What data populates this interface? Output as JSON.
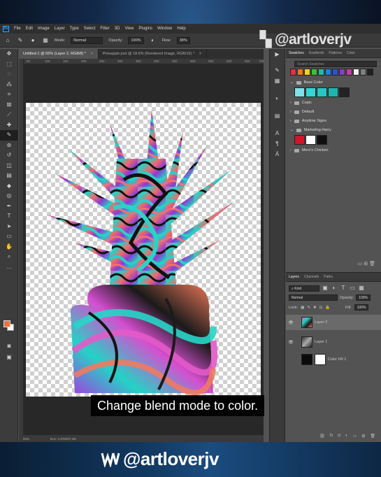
{
  "app": {
    "logo": "Ps"
  },
  "menu": [
    "File",
    "Edit",
    "Image",
    "Layer",
    "Type",
    "Select",
    "Filter",
    "3D",
    "View",
    "Plugins",
    "Window",
    "Help"
  ],
  "options": {
    "mode_label": "Mode:",
    "mode_value": "Normal",
    "opacity_label": "Opacity:",
    "opacity_value": "100%",
    "flow_label": "Flow:",
    "flow_value": "38%"
  },
  "doc_tabs": [
    {
      "label": "Untitled-1 @ 55% (Layer 2, RGB/8) *",
      "active": true
    },
    {
      "label": "Pineapple.psd @ 18.6% (Rendered Image, RGB/16) *",
      "active": false
    }
  ],
  "ruler_ticks": [
    "50",
    "100",
    "150",
    "200",
    "250",
    "300",
    "350",
    "400",
    "450",
    "500",
    "550",
    "600",
    "650",
    "700"
  ],
  "status": {
    "zoom": "55%",
    "doc": "Doc: 4.37M/37.2M"
  },
  "caption": "Change blend mode to color.",
  "watermark": "@artloverjv",
  "swatches_panel": {
    "tabs": [
      "Swatches",
      "Gradients",
      "Patterns",
      "Color"
    ],
    "search_placeholder": "Search Swatches",
    "recent_colors": [
      "#e03040",
      "#f07820",
      "#f0d020",
      "#3ac03a",
      "#28b8a0",
      "#2080e0",
      "#3050d0",
      "#8040c0",
      "#c040a0",
      "#f0f0f0",
      "#808080",
      "#202020"
    ],
    "groups": [
      {
        "name": "Base Color",
        "open": true,
        "colors": [
          "#7de3e8",
          "#35d6d6",
          "#27c7c2",
          "#1fb5ae",
          "#222222"
        ]
      },
      {
        "name": "Copic",
        "open": false
      },
      {
        "name": "Default",
        "open": false
      },
      {
        "name": "Anytime Signs",
        "open": false
      },
      {
        "name": "Marketing Harry",
        "open": true,
        "colors": [
          "#d0142c",
          "#ffffff",
          "#101010"
        ]
      },
      {
        "name": "Mero's Chicken",
        "open": false
      }
    ]
  },
  "layers_panel": {
    "tabs": [
      "Layers",
      "Channels",
      "Paths"
    ],
    "filter_label": "Kind",
    "blend_mode": "Normal",
    "opacity_label": "Opacity:",
    "opacity_value": "100%",
    "lock_label": "Lock:",
    "fill_label": "Fill:",
    "fill_value": "100%",
    "layers": [
      {
        "name": "Layer 2",
        "selected": true
      },
      {
        "name": "Layer 1",
        "selected": false
      },
      {
        "name": "Color Fill 1",
        "selected": false
      }
    ]
  },
  "tools": [
    "move-icon",
    "marquee-icon",
    "lasso-icon",
    "quick-select-icon",
    "crop-icon",
    "frame-icon",
    "eyedropper-icon",
    "healing-icon",
    "brush-icon",
    "clone-icon",
    "history-brush-icon",
    "eraser-icon",
    "gradient-icon",
    "blur-icon",
    "dodge-icon",
    "pen-icon",
    "type-icon",
    "path-select-icon",
    "shape-icon",
    "hand-icon",
    "zoom-icon",
    "more-icon"
  ],
  "colors": {
    "foreground": "#e8743b",
    "background": "#ffffff",
    "accent": "#31a8ff"
  }
}
